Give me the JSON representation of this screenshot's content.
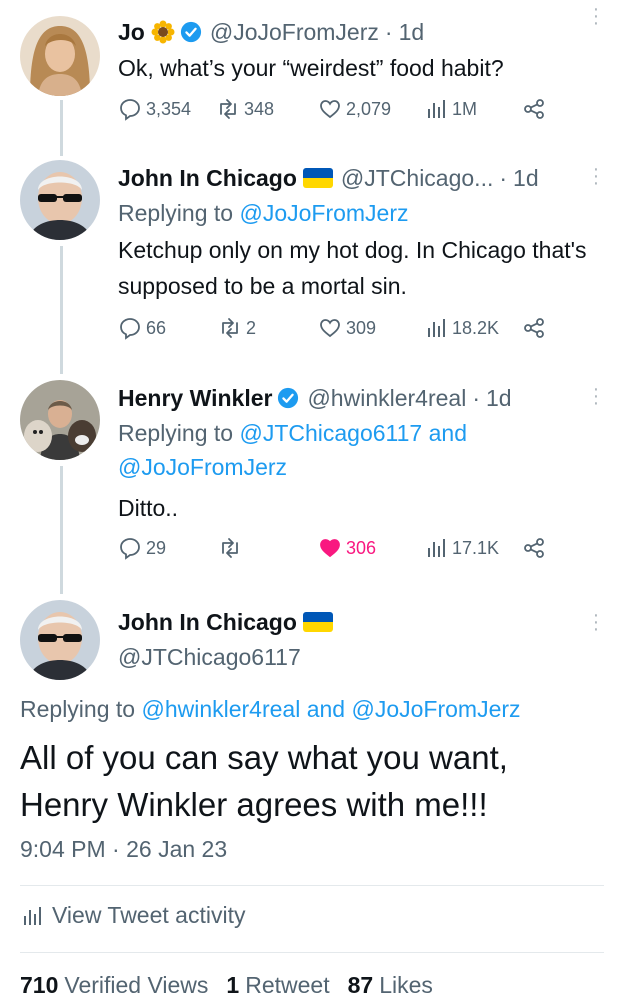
{
  "tweets": [
    {
      "name": "Jo",
      "handle": "@JoJoFromJerz",
      "dot": "·",
      "time": "1d",
      "text": "Ok, what’s your “weirdest” food habit?",
      "replies": "3,354",
      "retweets": "348",
      "likes": "2,079",
      "views": "1M"
    },
    {
      "name": "John In Chicago",
      "handle": "@JTChicago...",
      "dot": "·",
      "time": "1d",
      "reply_prefix": "Replying to ",
      "reply_to": "@JoJoFromJerz",
      "text": "Ketchup only on my hot dog. In Chicago that's supposed to be a mortal sin.",
      "replies": "66",
      "retweets": "2",
      "likes": "309",
      "views": "18.2K"
    },
    {
      "name": "Henry Winkler",
      "handle": "@hwinkler4real",
      "dot": "·",
      "time": "1d",
      "reply_prefix": "Replying to ",
      "reply_to_1": "@JTChicago6117",
      "reply_and": " and",
      "reply_to_2": "@JoJoFromJerz",
      "text": "Ditto..",
      "replies": "29",
      "retweets": "",
      "likes": "306",
      "views": "17.1K"
    }
  ],
  "main": {
    "name": "John In Chicago",
    "handle": "@JTChicago6117",
    "reply_prefix": "Replying to ",
    "reply_to_1": "@hwinkler4real",
    "reply_and": " and ",
    "reply_to_2": "@JoJoFromJerz",
    "text": "All of you can say what you want, Henry Winkler agrees with me!!!",
    "timestamp": "9:04 PM · 26 Jan 23",
    "activity_label": "View Tweet activity",
    "stats": {
      "views_count": "710",
      "views_label": "Verified Views",
      "retweets_count": "1",
      "retweets_label": "Retweet",
      "likes_count": "87",
      "likes_label": "Likes"
    }
  },
  "colors": {
    "link": "#1d9bf0",
    "verified": "#1d9bf0",
    "like_active": "#f91880",
    "flag_blue": "#0057b7",
    "flag_yellow": "#ffd700"
  },
  "icons": [
    "reply-icon",
    "retweet-icon",
    "like-icon",
    "views-icon",
    "share-icon",
    "verified-badge-icon",
    "sunflower-emoji-icon",
    "ukraine-flag-icon",
    "more-icon"
  ]
}
